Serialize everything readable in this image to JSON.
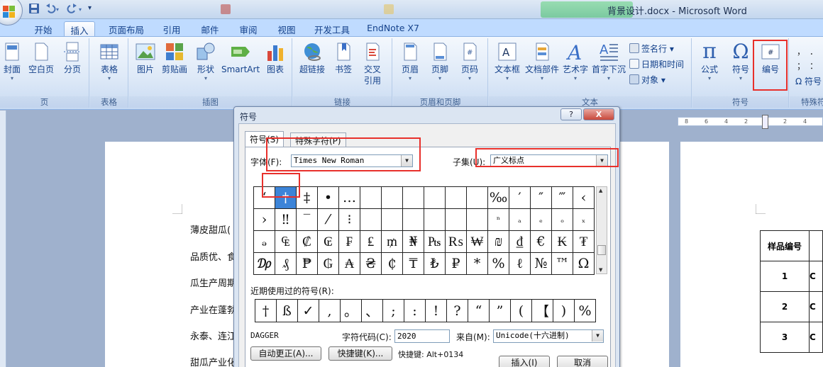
{
  "window": {
    "title": "背景设计.docx - Microsoft Word"
  },
  "colors": {
    "accent": "#15428b",
    "ribbon": "#dce8f7",
    "highlight_box": "#e8302b",
    "selected_symbol": "#3c84d8"
  },
  "ribbon": {
    "tabs": [
      {
        "label": "开始"
      },
      {
        "label": "插入"
      },
      {
        "label": "页面布局"
      },
      {
        "label": "引用"
      },
      {
        "label": "邮件"
      },
      {
        "label": "审阅"
      },
      {
        "label": "视图"
      },
      {
        "label": "开发工具"
      },
      {
        "label": "EndNote X7"
      }
    ],
    "active_tab": "插入",
    "groups": {
      "pages": {
        "label": "页",
        "buttons": [
          "封面",
          "空白页",
          "分页"
        ]
      },
      "tables": {
        "label": "表格",
        "buttons": [
          "表格"
        ]
      },
      "illustrations": {
        "label": "插图",
        "buttons": [
          "图片",
          "剪贴画",
          "形状",
          "SmartArt",
          "图表"
        ]
      },
      "links": {
        "label": "链接",
        "buttons": [
          "超链接",
          "书签",
          "交叉",
          "引用"
        ]
      },
      "header_footer": {
        "label": "页眉和页脚",
        "buttons": [
          "页眉",
          "页脚",
          "页码"
        ]
      },
      "text": {
        "label": "文本",
        "buttons": [
          "文本框",
          "文档部件",
          "艺术字",
          "首字下沉"
        ],
        "small": [
          "签名行",
          "日期和时间",
          "对象"
        ]
      },
      "symbols": {
        "label": "符号",
        "buttons": [
          "公式",
          "符号",
          "编号"
        ]
      },
      "special": {
        "label": "特殊符",
        "small": [
          "符号"
        ]
      }
    }
  },
  "document": {
    "lines": [
      "薄皮甜瓜(",
      "品质优、食",
      "瓜生产周期",
      "产业在蓬勃",
      "永泰、连江",
      "甜瓜产业化"
    ],
    "table": {
      "header": "样品编号",
      "rows": [
        "1",
        "2",
        "3"
      ],
      "clipped": "C"
    },
    "ruler_marks": [
      "8",
      "6",
      "4",
      "2",
      "2",
      "4"
    ]
  },
  "dialog": {
    "title": "符号",
    "help": "?",
    "close": "X",
    "tabs": [
      "符号(S)",
      "特殊字符(P)"
    ],
    "font_label": "字体(F):",
    "font_value": "Times New Roman",
    "subset_label": "子集(U):",
    "subset_value": "广义标点",
    "grid": [
      [
        "‘",
        "†",
        "‡",
        "•",
        "…",
        "",
        "",
        "",
        "",
        "",
        "",
        "‰",
        "′",
        "″",
        "‴",
        "‹"
      ],
      [
        "›",
        "‼",
        "‾",
        "⁄",
        "⁝",
        "",
        "",
        "",
        "",
        "",
        "",
        "ⁿ",
        "ₐ",
        "ₑ",
        "ₒ",
        "ₓ"
      ],
      [
        "ₔ",
        "₠",
        "₡",
        "₢",
        "₣",
        "₤",
        "₥",
        "₦",
        "₧",
        "₨",
        "₩",
        "₪",
        "₫",
        "€",
        "₭",
        "₮"
      ],
      [
        "₯",
        "₰",
        "₱",
        "₲",
        "₳",
        "₴",
        "₵",
        "₸",
        "₺",
        "₽",
        "*",
        "%",
        "ℓ",
        "№",
        "™",
        "Ω"
      ]
    ],
    "recent_label": "近期使用过的符号(R):",
    "recent": [
      "†",
      "ß",
      "✓",
      ",",
      "。",
      "、",
      ";",
      ":",
      "!",
      "?",
      "“",
      "”",
      "(",
      "【",
      ")",
      "%"
    ],
    "char_name": "DAGGER",
    "code_label": "字符代码(C):",
    "code_value": "2020",
    "from_label": "来自(M):",
    "from_value": "Unicode(十六进制)",
    "autocorrect_button": "自动更正(A)...",
    "shortcut_button": "快捷键(K)...",
    "shortcut_text": "快捷键: Alt+0134",
    "insert_button": "插入(I)",
    "cancel_button": "取消"
  }
}
